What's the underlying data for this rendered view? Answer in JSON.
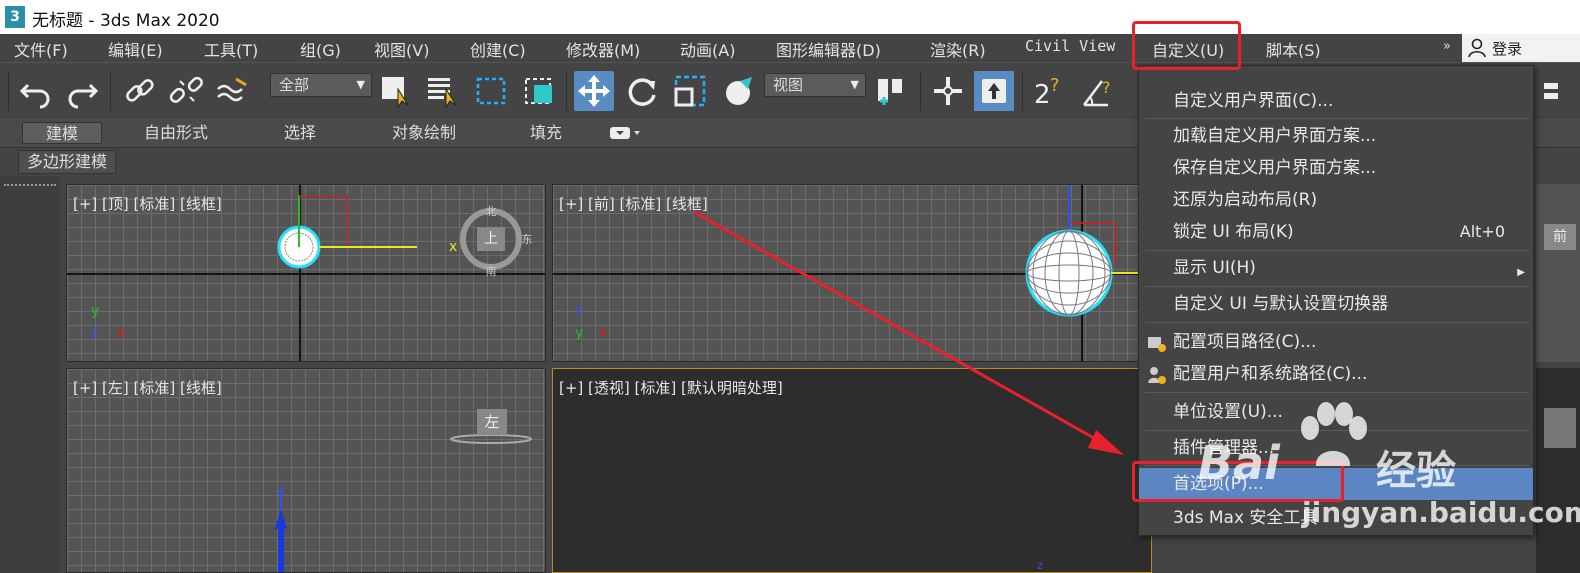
{
  "window": {
    "title": "无标题 - 3ds Max 2020",
    "logo_text": "3"
  },
  "menubar": {
    "items": [
      "文件(F)",
      "编辑(E)",
      "工具(T)",
      "组(G)",
      "视图(V)",
      "创建(C)",
      "修改器(M)",
      "动画(A)",
      "图形编辑器(D)",
      "渲染(R)",
      "Civil View",
      "自定义(U)",
      "脚本(S)"
    ],
    "overflow": "»",
    "login": "登录"
  },
  "toolbar": {
    "selection_filter": "全部",
    "ref_coord": "视图",
    "active_tool": "select-and-move"
  },
  "ribbon": {
    "tabs": [
      "建模",
      "自由形式",
      "选择",
      "对象绘制",
      "填充"
    ],
    "active_tab": "建模",
    "sub_label": "多边形建模"
  },
  "viewports": {
    "top": {
      "label": "[+] [顶] [标准] [线框]",
      "viewcube": "上"
    },
    "front": {
      "label": "[+] [前] [标准] [线框]",
      "viewcube": "前"
    },
    "left": {
      "label": "[+] [左] [标准] [线框]",
      "viewcube": "左"
    },
    "perspective": {
      "label": "[+] [透视] [标准] [默认明暗处理]"
    }
  },
  "customize_menu": {
    "items": [
      {
        "label": "自定义用户界面(C)...",
        "shortcut": ""
      },
      {
        "label": "加载自定义用户界面方案...",
        "shortcut": ""
      },
      {
        "label": "保存自定义用户界面方案...",
        "shortcut": ""
      },
      {
        "label": "还原为启动布局(R)",
        "shortcut": ""
      },
      {
        "label": "锁定 UI 布局(K)",
        "shortcut": "Alt+0"
      },
      {
        "label": "显示 UI(H)",
        "shortcut": ""
      },
      {
        "label": "自定义 UI 与默认设置切换器",
        "shortcut": ""
      },
      {
        "label": "配置项目路径(C)...",
        "shortcut": ""
      },
      {
        "label": "配置用户和系统路径(C)...",
        "shortcut": ""
      },
      {
        "label": "单位设置(U)...",
        "shortcut": ""
      },
      {
        "label": "插件管理器...",
        "shortcut": ""
      },
      {
        "label": "首选项(P)...",
        "shortcut": ""
      },
      {
        "label": "3ds Max 安全工具",
        "shortcut": ""
      }
    ],
    "highlighted": "首选项(P)..."
  },
  "watermark": {
    "brand": "Bai",
    "brand2": "经验",
    "url": "jingyan.baidu.com"
  },
  "colors": {
    "accent": "#5b86c2",
    "annotation": "#e8212a",
    "selection_cyan": "#22e0ff"
  }
}
